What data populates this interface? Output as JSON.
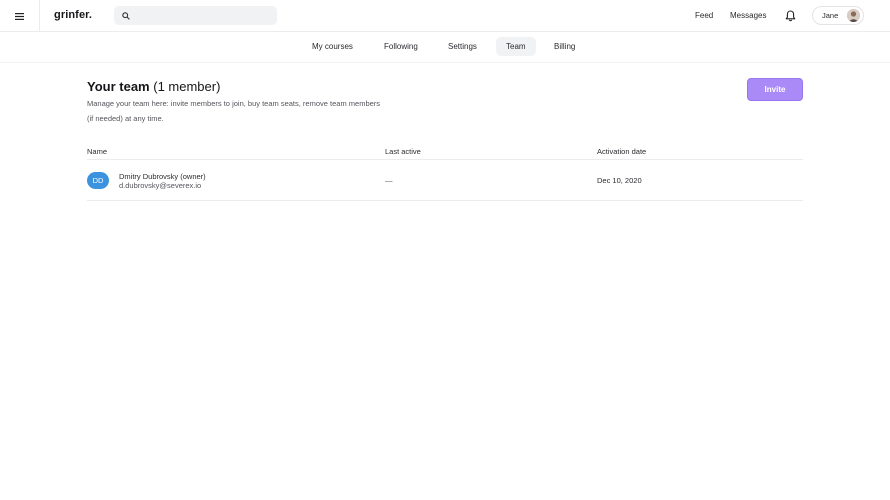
{
  "app": {
    "logo": "grinfer."
  },
  "search": {
    "placeholder": ""
  },
  "header": {
    "feed_label": "Feed",
    "messages_label": "Messages",
    "user_name": "Jane"
  },
  "tabs": [
    {
      "label": "My courses"
    },
    {
      "label": "Following"
    },
    {
      "label": "Settings"
    },
    {
      "label": "Team",
      "active": true
    },
    {
      "label": "Billing"
    }
  ],
  "team": {
    "title": "Your team",
    "member_count": "(1 member)",
    "description": "Manage your team here: invite members to join, buy team seats, remove team members (if needed) at any time.",
    "invite_label": "Invite"
  },
  "table": {
    "columns": [
      "Name",
      "Last active",
      "Activation date"
    ],
    "rows": [
      {
        "initials": "DD",
        "name": "Dmitry Dubrovsky (owner)",
        "email": "d.dubrovsky@severex.io",
        "last_active": "—",
        "activation_date": "Dec 10, 2020"
      }
    ]
  },
  "colors": {
    "accent": "#a98af7",
    "avatar": "#3b93e0"
  }
}
